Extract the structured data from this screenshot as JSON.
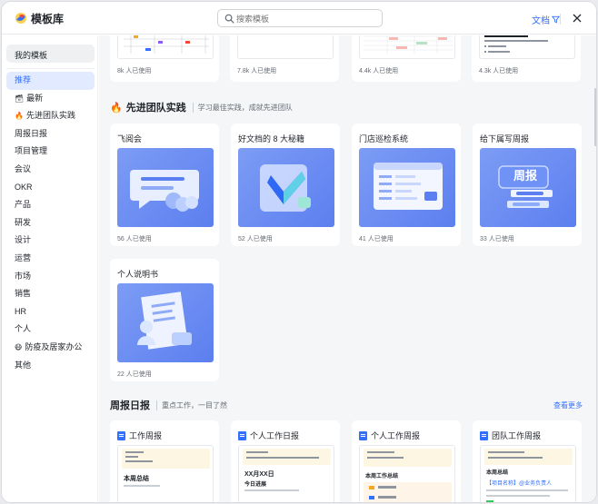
{
  "header": {
    "title": "模板库",
    "search_placeholder": "搜索模板",
    "doc_filter": "文档",
    "logo_icon": "feishu-logo-icon",
    "close_icon": "close-icon"
  },
  "sidebar": {
    "my_templates": "我的模板",
    "items": [
      {
        "label": "推荐",
        "active": true
      },
      {
        "label": "最新",
        "emoji": "🗃"
      },
      {
        "label": "先进团队实践",
        "emoji": "🔥"
      },
      {
        "label": "周报日报"
      },
      {
        "label": "项目管理"
      },
      {
        "label": "会议"
      },
      {
        "label": "OKR"
      },
      {
        "label": "产品"
      },
      {
        "label": "研发"
      },
      {
        "label": "设计"
      },
      {
        "label": "运营"
      },
      {
        "label": "市场"
      },
      {
        "label": "销售"
      },
      {
        "label": "HR"
      },
      {
        "label": "个人"
      },
      {
        "label": "防疫及居家办公",
        "emoji": "😷"
      },
      {
        "label": "其他"
      }
    ]
  },
  "top_row": [
    {
      "usage": "8k 人已使用"
    },
    {
      "usage": "7.8k 人已使用"
    },
    {
      "usage": "4.4k 人已使用"
    },
    {
      "usage": "4.3k 人已使用"
    }
  ],
  "advanced_section": {
    "emoji": "🔥",
    "title": "先进团队实践",
    "subtitle": "学习最佳实践，成就先进团队",
    "cards": [
      {
        "title": "飞阅会",
        "usage": "56 人已使用"
      },
      {
        "title": "好文档的 8 大秘籍",
        "usage": "52 人已使用"
      },
      {
        "title": "门店巡检系统",
        "usage": "41 人已使用"
      },
      {
        "title": "给下属写周报",
        "usage": "33 人已使用",
        "thumb_text": "周报"
      },
      {
        "title": "个人说明书",
        "usage": "22 人已使用"
      }
    ]
  },
  "weekly_section": {
    "title": "周报日报",
    "subtitle": "重点工作，一目了然",
    "see_more": "查看更多",
    "cards": [
      {
        "title": "工作周报",
        "preview": [
          "本周总结"
        ]
      },
      {
        "title": "个人工作日报",
        "preview": [
          "XX月XX日",
          "今日进展"
        ]
      },
      {
        "title": "个人工作周报",
        "preview": [
          "本周工作总结"
        ]
      },
      {
        "title": "团队工作周报",
        "preview": [
          "本周总结",
          "【项目名称】@业务负责人"
        ]
      }
    ]
  },
  "colors": {
    "accent": "#3370ff",
    "active_bg": "#e1eaff",
    "content_bg": "#f5f6f7",
    "thumb_blue": "#6b8cf2"
  }
}
